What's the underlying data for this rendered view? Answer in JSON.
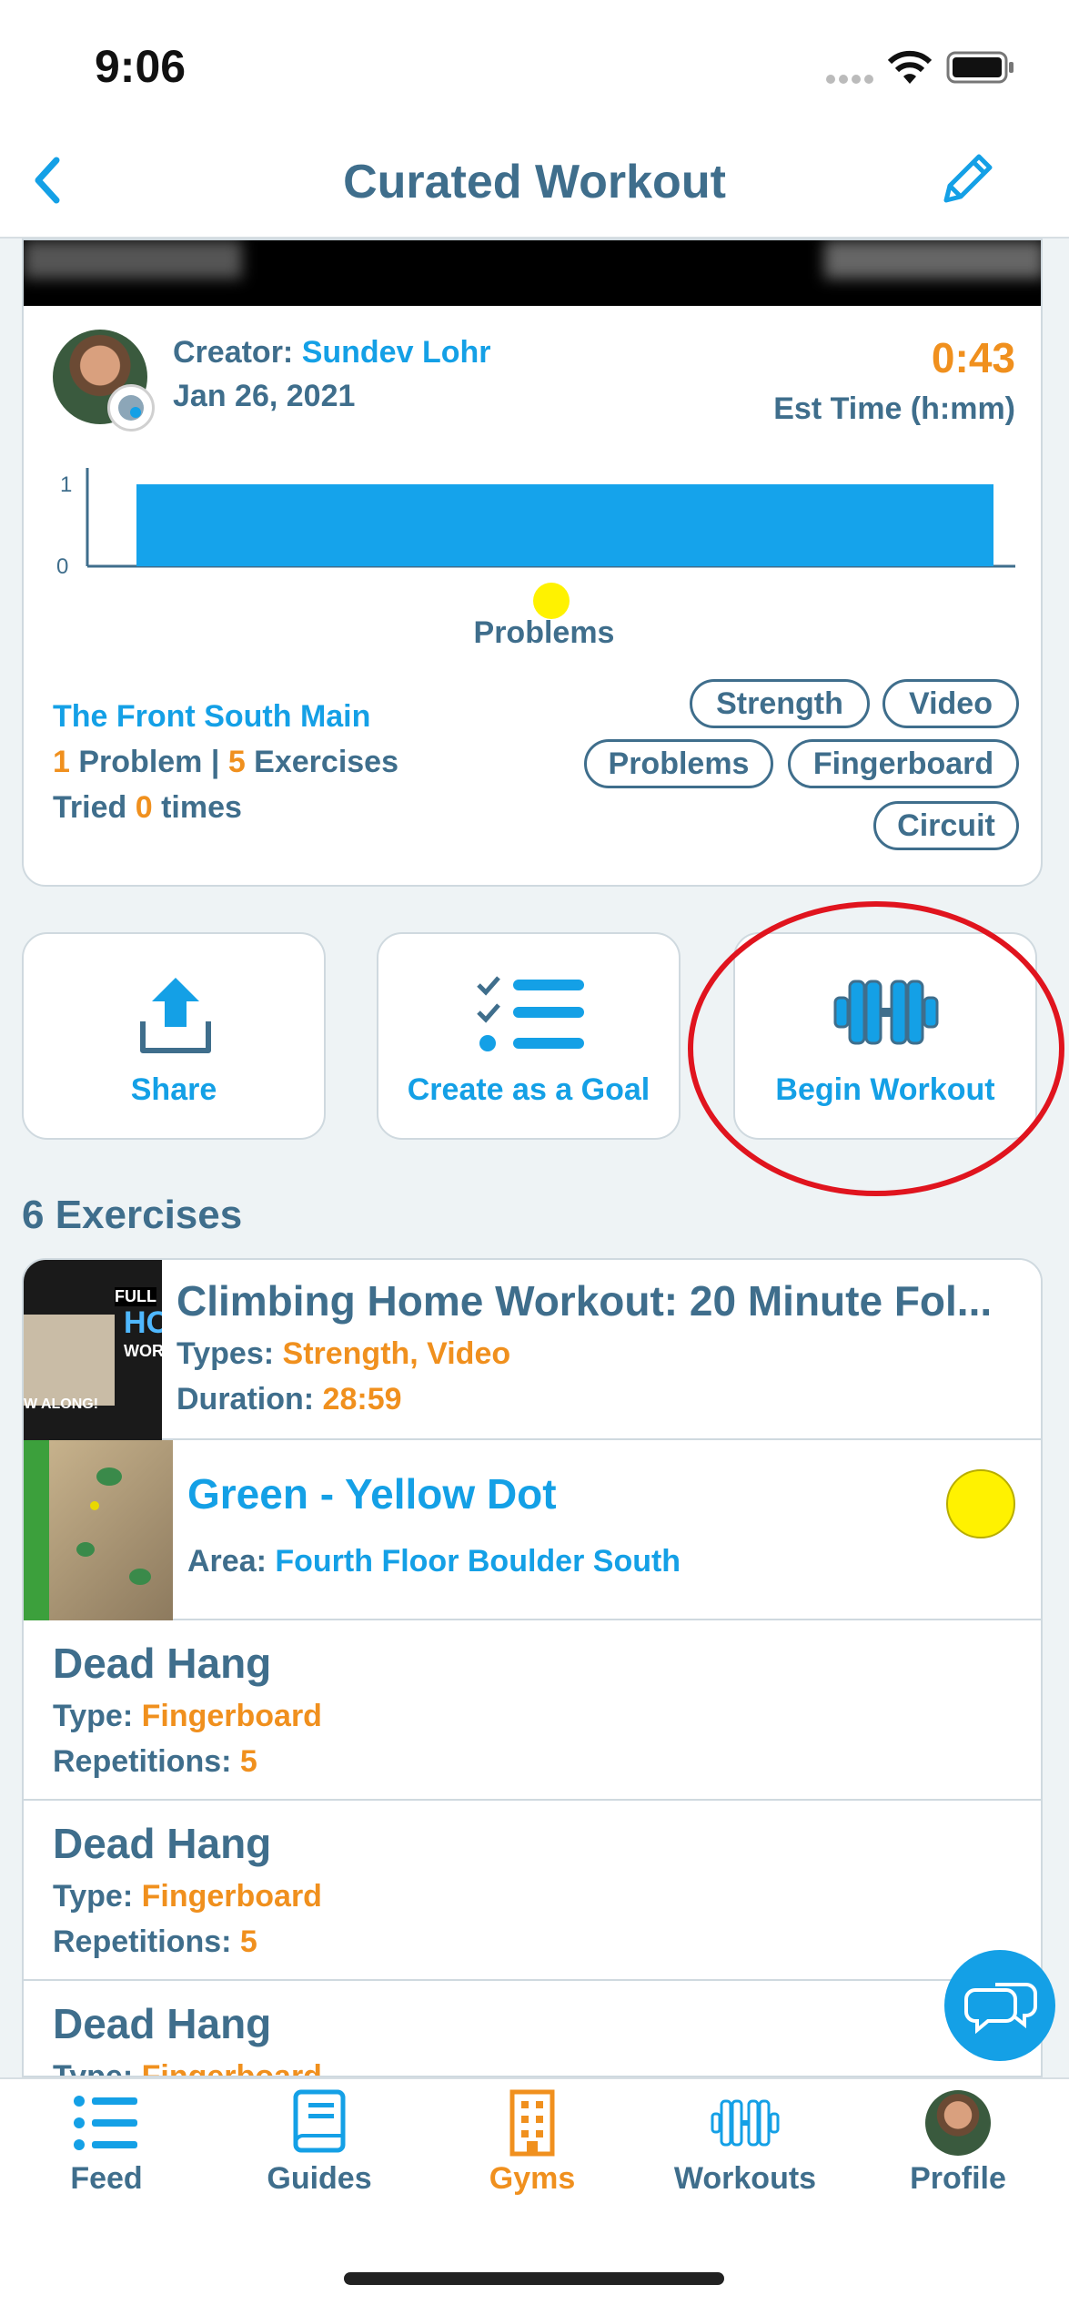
{
  "status": {
    "time": "9:06"
  },
  "nav": {
    "title": "Curated Workout"
  },
  "workout": {
    "creator_prefix": "Creator: ",
    "creator_name": "Sundev Lohr",
    "date": "Jan 26, 2021",
    "est_time": "0:43",
    "est_time_label": "Est Time (h:mm)",
    "gym": "The Front South Main",
    "problem_count": "1",
    "problem_label": " Problem | ",
    "exercise_count": "5",
    "exercise_label": " Exercises",
    "tried_prefix": "Tried ",
    "tried_count": "0",
    "tried_suffix": " times",
    "tags": [
      "Strength",
      "Video",
      "Problems",
      "Fingerboard",
      "Circuit"
    ]
  },
  "chart_data": {
    "type": "bar",
    "categories": [
      ""
    ],
    "values": [
      1
    ],
    "xlabel": "Problems",
    "ylabel": "",
    "ylim": [
      0,
      1
    ],
    "yticks": [
      "1",
      "0"
    ],
    "colors": {
      "bar": "#15a3eb",
      "marker": "#fff200"
    }
  },
  "actions": {
    "share": "Share",
    "goal": "Create as a Goal",
    "begin": "Begin Workout"
  },
  "exercises": {
    "heading": "6 Exercises",
    "items": [
      {
        "title": "Climbing Home Workout: 20 Minute Fol...",
        "l1_key": "Types: ",
        "l1_val": "Strength, Video",
        "l2_key": "Duration: ",
        "l2_val": "28:59",
        "thumb_text_1": "FULL",
        "thumb_text_2": "HO",
        "thumb_text_3": "WORK",
        "thumb_text_4": "W ALONG!"
      },
      {
        "title": "Green - Yellow Dot",
        "l1_key": "Area: ",
        "l1_val": "Fourth Floor Boulder South"
      },
      {
        "title": "Dead Hang",
        "l1_key": "Type: ",
        "l1_val": "Fingerboard",
        "l2_key": "Repetitions: ",
        "l2_val": "5"
      },
      {
        "title": "Dead Hang",
        "l1_key": "Type: ",
        "l1_val": "Fingerboard",
        "l2_key": "Repetitions: ",
        "l2_val": "5"
      },
      {
        "title": "Dead Hang",
        "l1_key": "Type: ",
        "l1_val": "Fingerboard"
      }
    ]
  },
  "tabs": [
    {
      "label": "Feed",
      "icon": "list-icon"
    },
    {
      "label": "Guides",
      "icon": "book-icon"
    },
    {
      "label": "Gyms",
      "icon": "building-icon"
    },
    {
      "label": "Workouts",
      "icon": "dumbbell-icon"
    },
    {
      "label": "Profile",
      "icon": "avatar"
    }
  ],
  "colors": {
    "accent": "#14a0e6",
    "orange": "#f0901e",
    "text": "#3f6e8c",
    "highlight_ring": "#e0141e"
  }
}
